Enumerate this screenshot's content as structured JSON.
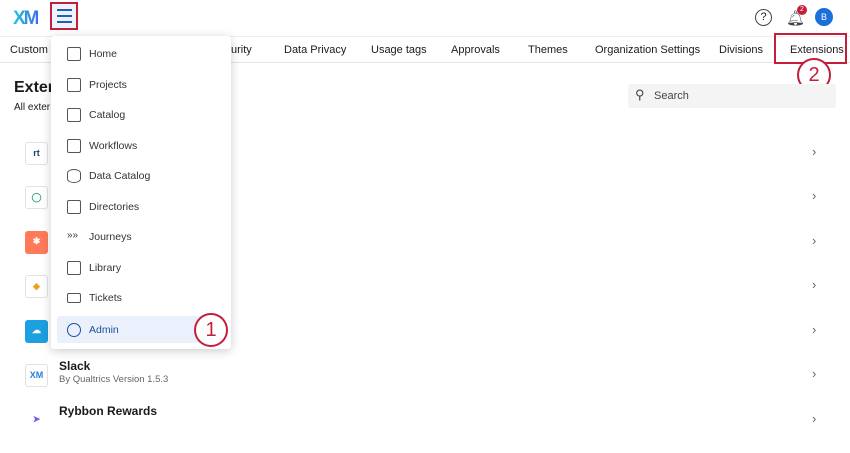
{
  "header": {
    "logo": "XM",
    "help": "?",
    "notifications": "2",
    "avatar": "B"
  },
  "tabs": [
    "Custom S",
    "urity",
    "Data Privacy",
    "Usage tags",
    "Approvals",
    "Themes",
    "Organization Settings",
    "Divisions",
    "Extensions"
  ],
  "page": {
    "title": "Exten",
    "subtitle": "All exter",
    "search_placeholder": "Search"
  },
  "rows": [
    {
      "icon": "rt",
      "name": "",
      "meta": ""
    },
    {
      "icon": "◯",
      "name": "",
      "meta": ""
    },
    {
      "icon": "✱",
      "name": "",
      "meta": ""
    },
    {
      "icon": "◆",
      "name": "",
      "meta": ""
    },
    {
      "icon": "☁",
      "name": "",
      "meta": ""
    },
    {
      "icon": "XM",
      "name": "Slack",
      "meta": "By Qualtrics   Version 1.5.3"
    },
    {
      "icon": "➤",
      "name": "Rybbon Rewards",
      "meta": ""
    }
  ],
  "menu": [
    "Home",
    "Projects",
    "Catalog",
    "Workflows",
    "Data Catalog",
    "Directories",
    "Journeys",
    "Library",
    "Tickets",
    "Admin"
  ],
  "callouts": [
    "1",
    "2"
  ],
  "colors": {
    "accent": "#c41e3a",
    "brand": "#1a6fd9"
  }
}
